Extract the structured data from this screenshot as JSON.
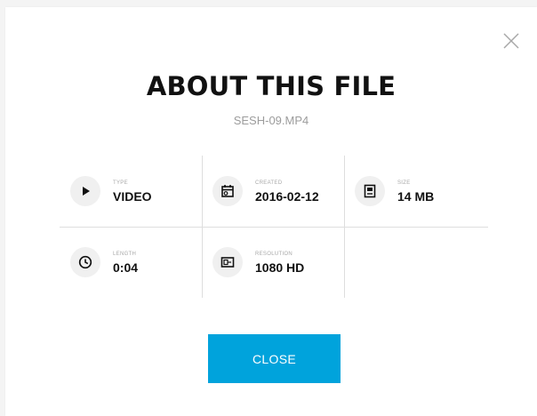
{
  "dialog": {
    "title": "ABOUT THIS FILE",
    "filename": "SESH-09.MP4",
    "close_label": "CLOSE"
  },
  "details": [
    {
      "label": "TYPE",
      "value": "VIDEO",
      "icon": "play-icon"
    },
    {
      "label": "CREATED",
      "value": "2016-02-12",
      "icon": "calendar-icon"
    },
    {
      "label": "SIZE",
      "value": "14 MB",
      "icon": "storage-icon"
    },
    {
      "label": "LENGTH",
      "value": "0:04",
      "icon": "clock-icon"
    },
    {
      "label": "RESOLUTION",
      "value": "1080 HD",
      "icon": "resolution-icon"
    }
  ],
  "colors": {
    "accent": "#00a3dc",
    "text": "#111111",
    "muted": "#9c9c9c"
  }
}
